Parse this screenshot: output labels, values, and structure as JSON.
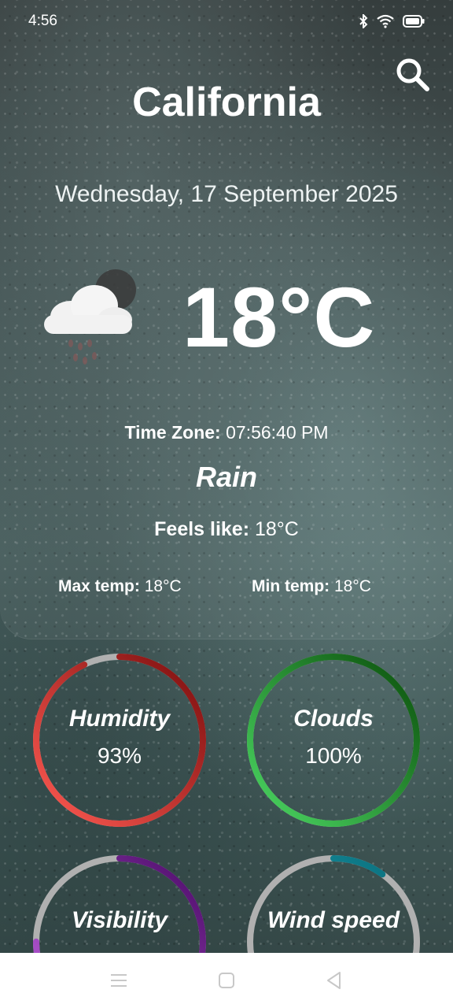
{
  "status_bar": {
    "time": "4:56",
    "icons": [
      "bluetooth-icon",
      "wifi-icon",
      "battery-icon"
    ]
  },
  "header": {
    "city": "California",
    "date": "Wednesday, 17 September 2025",
    "search_icon": "search-icon"
  },
  "current": {
    "icon": "rain-cloud-icon",
    "temperature": "18°C",
    "time_zone_label": "Time Zone:",
    "time_zone_value": " 07:56:40 PM",
    "condition": "Rain",
    "feels_like_label": "Feels like:",
    "feels_like_value": " 18°C",
    "max_temp_label": "Max temp:",
    "max_temp_value": " 18°C",
    "min_temp_label": "Min temp:",
    "min_temp_value": " 18°C"
  },
  "metrics": [
    {
      "label": "Humidity",
      "value": "93%",
      "level": 0.93,
      "color_start": "#ff5a52",
      "color_end": "#7a0d0d"
    },
    {
      "label": "Clouds",
      "value": "100%",
      "level": 1.0,
      "color_start": "#4cd964",
      "color_end": "#0a4d0a"
    },
    {
      "label": "Visibility",
      "value": "",
      "level": 0.75,
      "color_start": "#c060e0",
      "color_end": "#4a0a66"
    },
    {
      "label": "Wind speed",
      "value": "",
      "level": 0.1,
      "color_start": "#20b8c8",
      "color_end": "#0a6a78"
    }
  ],
  "nav_bar": {
    "icons": [
      "menu-icon",
      "home-icon",
      "back-icon"
    ]
  },
  "colors": {
    "track": "#b0b0b0",
    "text": "#ffffff",
    "nav_bg": "#ffffff",
    "nav_icon": "#c8c8c8"
  }
}
